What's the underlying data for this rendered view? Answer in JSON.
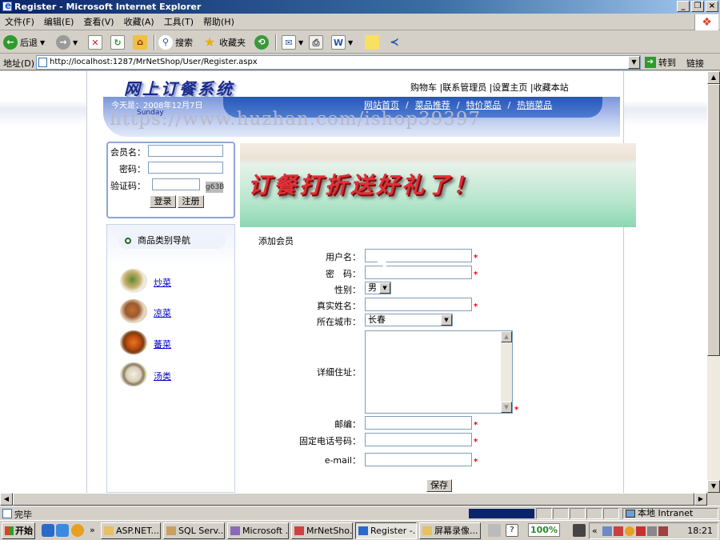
{
  "window": {
    "title": "Register - Microsoft Internet Explorer",
    "buttons": {
      "minimize": "_",
      "maximize": "❐",
      "close": "×"
    }
  },
  "menu": [
    "文件(F)",
    "编辑(E)",
    "查看(V)",
    "收藏(A)",
    "工具(T)",
    "帮助(H)"
  ],
  "toolbar": {
    "back": "后退",
    "search": "搜索",
    "favorites": "收藏夹"
  },
  "address": {
    "label": "地址(D)",
    "url": "http://localhost:1287/MrNetShop/User/Register.aspx",
    "go": "转到",
    "links": "链接"
  },
  "site": {
    "logo": "网上订餐系统",
    "toplinks": "购物车 |联系管理员 |设置主页 |收藏本站",
    "date": "今天是：2008年12月7日",
    "weekday": "Sunday",
    "nav": [
      "网站首页",
      "菜品推荐",
      "特价菜品",
      "热销菜品"
    ],
    "watermark": "https://www.huzhan.com/ishop39397"
  },
  "login": {
    "member_label": "会员名：",
    "password_label": "密码：",
    "captcha_label": "验证码：",
    "captcha_value": "g63B",
    "login_button": "登录",
    "register_button": "注册"
  },
  "categories": {
    "heading": "商品类别导航",
    "items": [
      "炒菜",
      "凉菜",
      "蕃菜",
      "汤类"
    ]
  },
  "promo": {
    "text": "订餐打折送好礼了！"
  },
  "form": {
    "title": "添加会员",
    "username_label": "用户名：",
    "password_label": "密　码：",
    "gender_label": "性别：",
    "gender_value": "男",
    "realname_label": "真实姓名：",
    "city_label": "所在城市：",
    "city_value": "长春",
    "address_label": "详细住址：",
    "postcode_label": "邮编：",
    "phone_label": "固定电话号码：",
    "email_label": "e-mail：",
    "required_mark": "*",
    "save_button": "保存"
  },
  "status": {
    "text": "完毕",
    "zone": "本地 Intranet"
  },
  "taskbar": {
    "start": "开始",
    "tasks": [
      "ASP.NET...",
      "SQL Serv...",
      "Microsoft ...",
      "MrNetSho...",
      "Register -...",
      "屏幕录像..."
    ],
    "zoom": "100%",
    "clock": "18:21"
  }
}
